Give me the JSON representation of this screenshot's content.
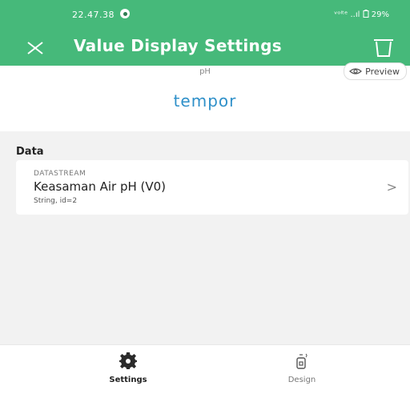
{
  "status_bar": {
    "time": "22.47.38",
    "indicators": "ᵛᵒˡᵗᵉ ..ıl",
    "battery": "29%"
  },
  "header": {
    "title": "Value Display Settings",
    "close_icon": "close-icon",
    "delete_icon": "trash-icon",
    "background_color": "#46b97a"
  },
  "preview": {
    "unit_label": "pH",
    "button_label": "Preview",
    "value_text": "tempor",
    "value_color": "#2f90c9"
  },
  "data_section": {
    "title": "Data",
    "datastream": {
      "label": "DATASTREAM",
      "name": "Keasaman Air pH  (V0)",
      "meta": "String, id=2"
    }
  },
  "bottom_nav": {
    "items": [
      {
        "label": "Settings",
        "icon": "gear-icon",
        "active": true
      },
      {
        "label": "Design",
        "icon": "design-icon",
        "active": false
      }
    ]
  }
}
